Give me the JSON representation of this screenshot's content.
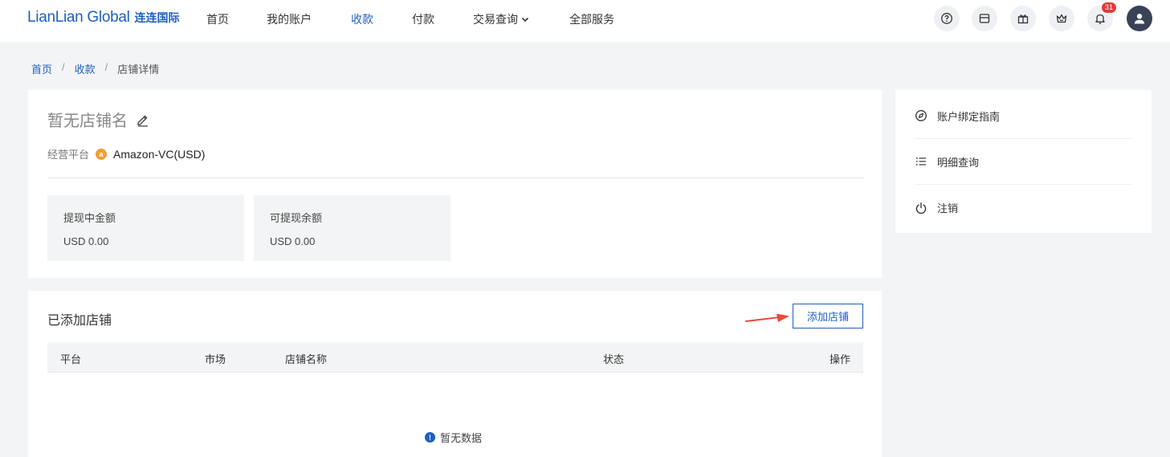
{
  "header": {
    "logo_en": "LianLian Global",
    "logo_cn": "连连国际",
    "nav": [
      {
        "label": "首页"
      },
      {
        "label": "我的账户"
      },
      {
        "label": "收款",
        "active": true
      },
      {
        "label": "付款"
      },
      {
        "label": "交易查询",
        "dropdown": true
      },
      {
        "label": "全部服务"
      }
    ],
    "icons": [
      "help-icon",
      "wallet-icon",
      "gift-icon",
      "crown-icon",
      "bell-icon"
    ],
    "notification_count": "31",
    "accent_color": "#1f5fbf"
  },
  "breadcrumb": {
    "items": [
      "首页",
      "收款"
    ],
    "current": "店铺详情",
    "separator": "/"
  },
  "store": {
    "name": "暂无店铺名",
    "platform_label": "经营平台",
    "platform_icon_letter": "a",
    "platform_value": "Amazon-VC(USD)",
    "stats": [
      {
        "label": "提现中金额",
        "value": "USD 0.00"
      },
      {
        "label": "可提现余额",
        "value": "USD 0.00"
      }
    ]
  },
  "side_menu": [
    {
      "label": "账户绑定指南",
      "icon": "compass-icon"
    },
    {
      "label": "明细查询",
      "icon": "list-icon"
    },
    {
      "label": "注销",
      "icon": "power-icon"
    }
  ],
  "stores_table": {
    "title": "已添加店铺",
    "add_button": "添加店铺",
    "columns": [
      "平台",
      "市场",
      "店铺名称",
      "状态",
      "操作"
    ],
    "empty_text": "暂无数据",
    "empty_icon": "!"
  }
}
